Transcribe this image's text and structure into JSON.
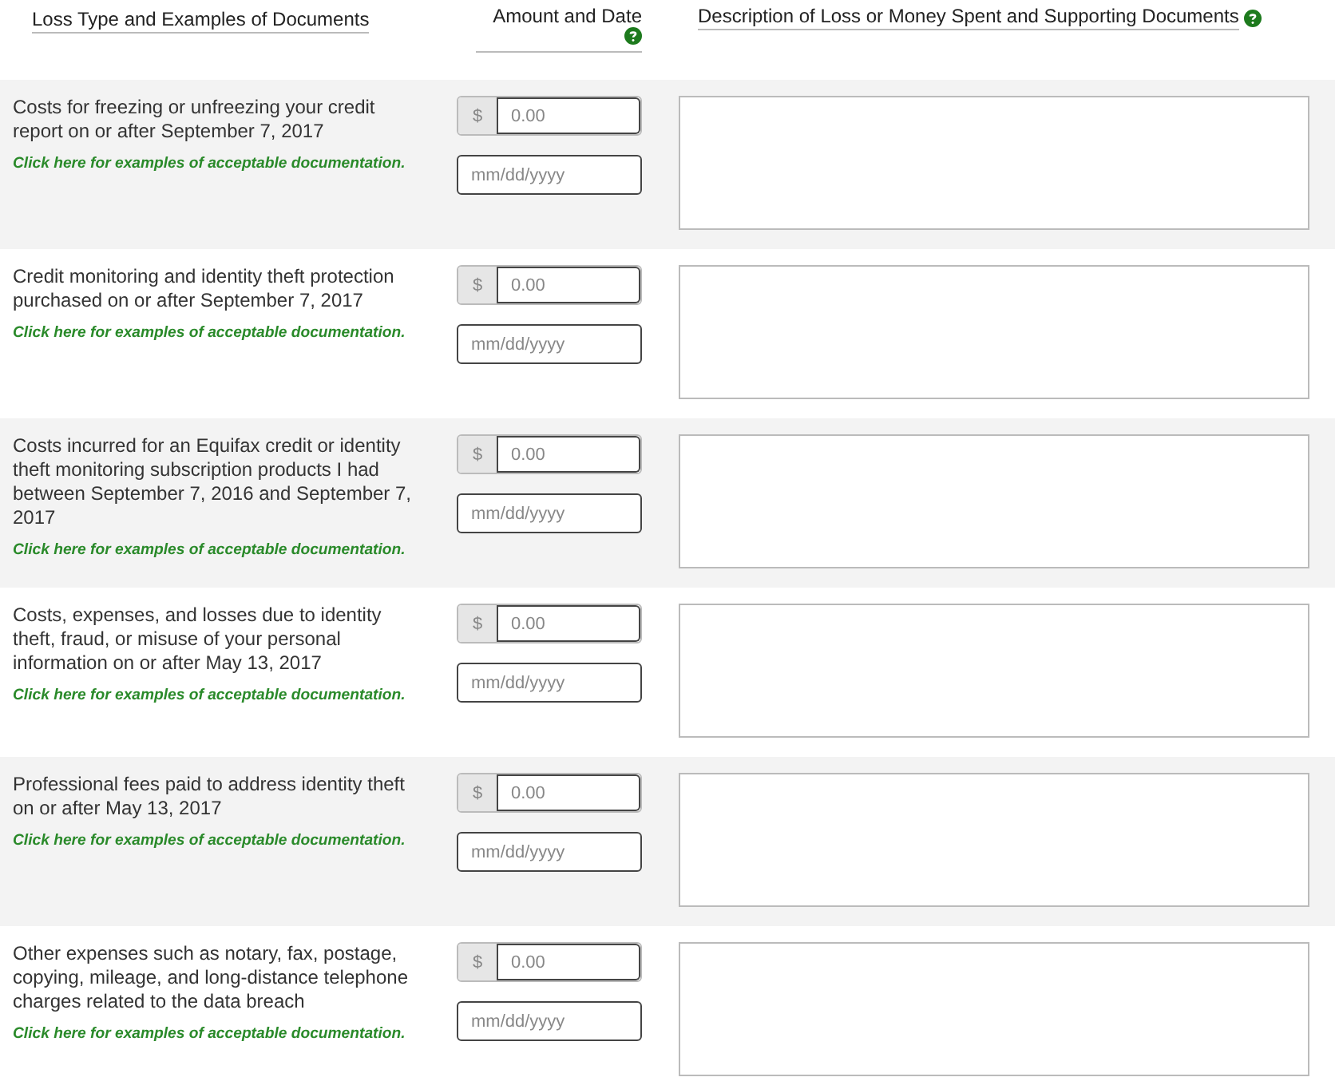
{
  "columns": [
    {
      "title": "Loss Type and Examples of Documents"
    },
    {
      "title": "Amount and Date"
    },
    {
      "title": "Description of Loss or Money Spent and Supporting Documents"
    }
  ],
  "rows": [
    {
      "loss_type": "Costs for freezing or unfreezing your credit report on or after September 7, 2017",
      "link": "Click here for examples of acceptable documentation.",
      "currency": "$",
      "amount_placeholder": "0.00",
      "date_placeholder": "mm/dd/yyyy"
    },
    {
      "loss_type": "Credit monitoring and identity theft protection purchased on or after September 7, 2017",
      "link": "Click here for examples of acceptable documentation.",
      "currency": "$",
      "amount_placeholder": "0.00",
      "date_placeholder": "mm/dd/yyyy"
    },
    {
      "loss_type": "Costs incurred for an Equifax credit or identity theft monitoring subscription products I had between September 7, 2016 and September 7, 2017",
      "link": "Click here for examples of acceptable documentation.",
      "currency": "$",
      "amount_placeholder": "0.00",
      "date_placeholder": "mm/dd/yyyy"
    },
    {
      "loss_type": "Costs, expenses, and losses due to identity theft, fraud, or misuse of your personal information on or after May 13, 2017",
      "link": "Click here for examples of acceptable documentation.",
      "currency": "$",
      "amount_placeholder": "0.00",
      "date_placeholder": "mm/dd/yyyy"
    },
    {
      "loss_type": "Professional fees paid to address identity theft on or after May 13, 2017",
      "link": "Click here for examples of acceptable documentation.",
      "currency": "$",
      "amount_placeholder": "0.00",
      "date_placeholder": "mm/dd/yyyy"
    },
    {
      "loss_type": "Other expenses such as notary, fax, postage, copying, mileage, and long-distance telephone charges related to the data breach",
      "link": "Click here for examples of acceptable documentation.",
      "currency": "$",
      "amount_placeholder": "0.00",
      "date_placeholder": "mm/dd/yyyy"
    }
  ]
}
